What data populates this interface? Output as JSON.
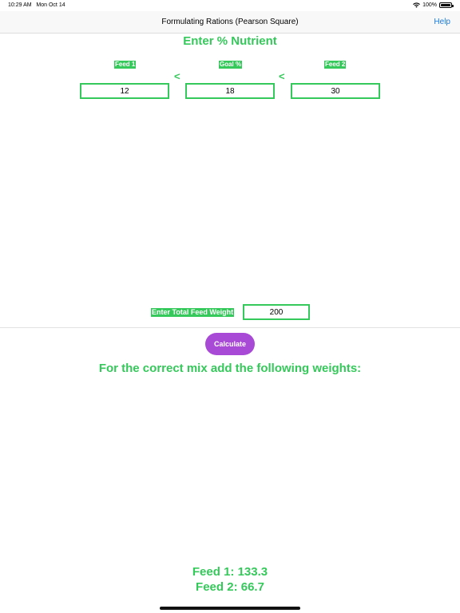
{
  "status_bar": {
    "time": "10:29 AM",
    "date": "Mon Oct 14",
    "battery": "100%",
    "battery_level": 1.0,
    "wifi_icon": "wifi-icon",
    "battery_icon": "battery-icon"
  },
  "nav": {
    "title": "Formulating Rations (Pearson Square)",
    "help_label": "Help"
  },
  "main": {
    "heading": "Enter % Nutrient",
    "feed1_label": "Feed 1",
    "goal_label": "Goal %",
    "feed2_label": "Feed 2",
    "compare_symbol_1": "<",
    "compare_symbol_2": "<",
    "feed1_value": "12",
    "goal_value": "18",
    "feed2_value": "30",
    "total_weight_label": "Enter Total Feed Weight",
    "total_weight_value": "200",
    "calculate_label": "Calculate",
    "result_heading": "For the correct mix add the following weights:",
    "result_feed1": "Feed 1: 133.3",
    "result_feed2": "Feed 2: 66.7"
  },
  "colors": {
    "accent_green": "#35c85a",
    "button_purple": "#a94ad6",
    "link_blue": "#1a7ae0"
  }
}
